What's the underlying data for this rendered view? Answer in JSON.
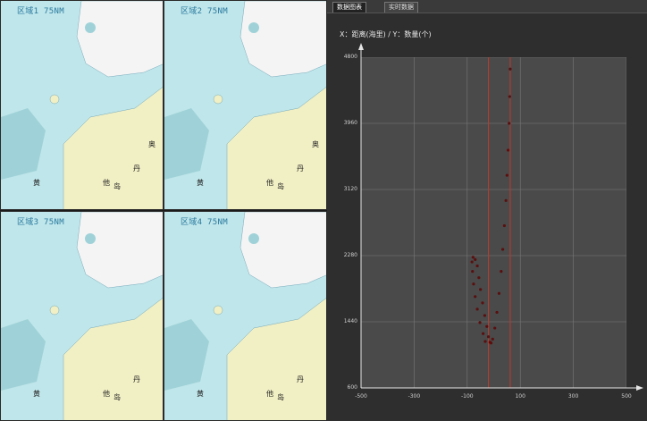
{
  "map_tiles": [
    {
      "label": "区域1 75NM",
      "place1": "奥",
      "place2": "丹",
      "place3": "他",
      "place4": "岛",
      "place5": "黄"
    },
    {
      "label": "区域2 75NM",
      "place1": "奥",
      "place2": "丹",
      "place3": "他",
      "place4": "岛",
      "place5": "黄"
    },
    {
      "label": "区域3 75NM",
      "place1": "丹",
      "place2": "他",
      "place3": "岛",
      "place4": "黄",
      "place5": ""
    },
    {
      "label": "区域4 75NM",
      "place1": "丹",
      "place2": "他",
      "place3": "岛",
      "place4": "黄",
      "place5": ""
    }
  ],
  "tabs": [
    {
      "label": "数据图表",
      "active": true
    },
    {
      "label": "实时数据",
      "active": false
    }
  ],
  "axis_title": "X：距离(海里) / Y：数量(个)",
  "chart_data": {
    "type": "scatter",
    "title": "",
    "xlabel": "",
    "ylabel": "",
    "xlim": [
      -500,
      500
    ],
    "ylim": [
      600,
      4800
    ],
    "x_ticks": [
      -500,
      -300,
      -100,
      100,
      300,
      500
    ],
    "x_tick_labels": [
      "-500",
      "-300",
      "-100",
      "100",
      "300",
      "500"
    ],
    "y_ticks": [
      600,
      1440,
      2280,
      3120,
      3960,
      4800
    ],
    "y_tick_labels": [
      "600",
      "1440",
      "2280",
      "3120",
      "3960",
      "4800"
    ],
    "vertical_lines": [
      -20,
      62
    ],
    "series": [
      {
        "name": "",
        "color": "#5a0f0f",
        "points": [
          [
            -32,
            1190
          ],
          [
            -40,
            1290
          ],
          [
            -52,
            1430
          ],
          [
            -62,
            1600
          ],
          [
            -70,
            1760
          ],
          [
            -76,
            1920
          ],
          [
            -80,
            2080
          ],
          [
            -82,
            2200
          ],
          [
            -78,
            2260
          ],
          [
            -70,
            2230
          ],
          [
            -62,
            2150
          ],
          [
            -56,
            2000
          ],
          [
            -50,
            1850
          ],
          [
            -42,
            1680
          ],
          [
            -34,
            1520
          ],
          [
            -26,
            1380
          ],
          [
            -20,
            1250
          ],
          [
            -14,
            1180
          ],
          [
            -10,
            1170
          ],
          [
            -4,
            1220
          ],
          [
            4,
            1360
          ],
          [
            12,
            1560
          ],
          [
            20,
            1800
          ],
          [
            28,
            2080
          ],
          [
            34,
            2360
          ],
          [
            40,
            2660
          ],
          [
            46,
            2980
          ],
          [
            50,
            3300
          ],
          [
            54,
            3620
          ],
          [
            58,
            3960
          ],
          [
            60,
            4300
          ],
          [
            62,
            4650
          ]
        ]
      }
    ]
  },
  "colors": {
    "vline": "#c0392b",
    "grid": "#7a7a7a",
    "plot_bg": "#4a4a4a"
  }
}
